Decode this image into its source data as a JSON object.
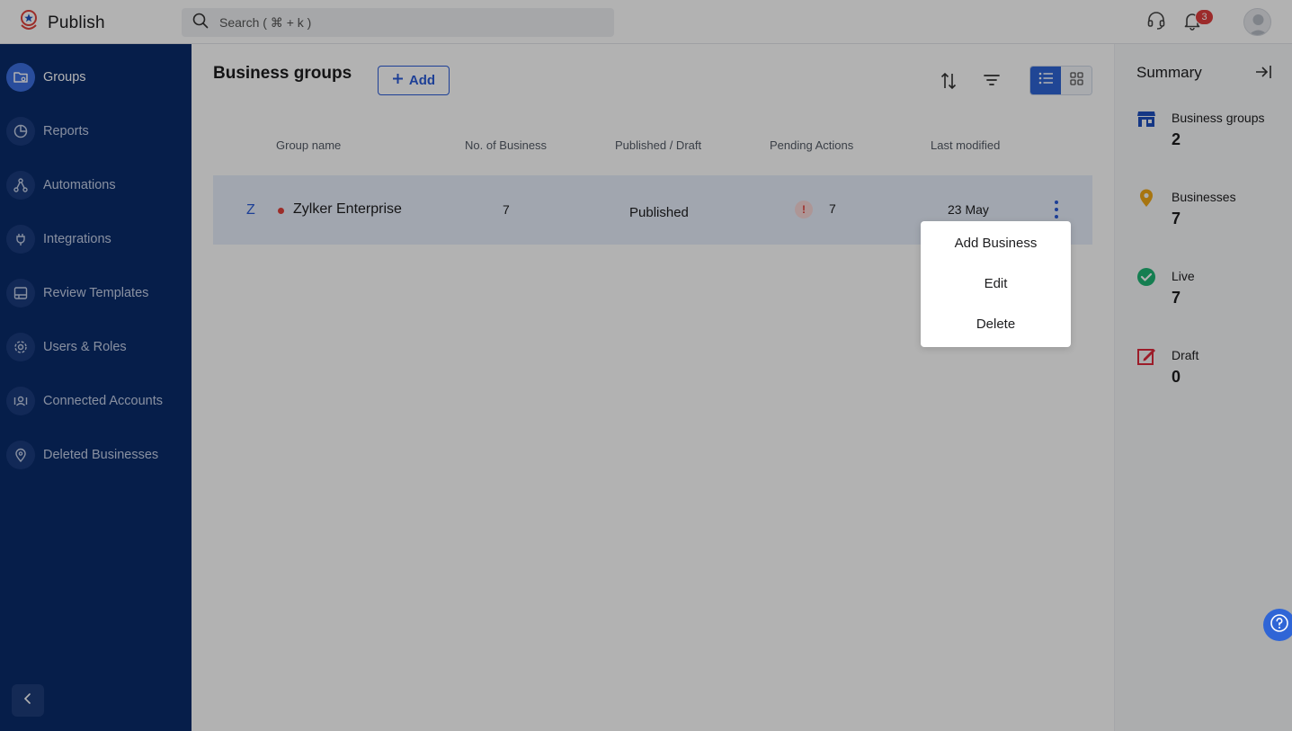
{
  "app": {
    "name": "Publish"
  },
  "search": {
    "placeholder": "Search ( ⌘ + k )"
  },
  "topbar": {
    "notification_count": "3"
  },
  "sidebar": {
    "items": [
      {
        "label": "Groups",
        "icon": "groups-icon",
        "active": true
      },
      {
        "label": "Reports",
        "icon": "reports-icon"
      },
      {
        "label": "Automations",
        "icon": "automations-icon"
      },
      {
        "label": "Integrations",
        "icon": "integrations-icon"
      },
      {
        "label": "Review Templates",
        "icon": "review-templates-icon"
      },
      {
        "label": "Users & Roles",
        "icon": "users-roles-icon"
      },
      {
        "label": "Connected Accounts",
        "icon": "connected-accounts-icon"
      },
      {
        "label": "Deleted Businesses",
        "icon": "deleted-businesses-icon"
      }
    ]
  },
  "main": {
    "title": "Business groups",
    "add_label": "Add",
    "columns": [
      "Group name",
      "No. of Business",
      "Published / Draft",
      "Pending Actions",
      "Last modified"
    ],
    "rows": [
      {
        "initial": "Z",
        "name": "Zylker Enterprise",
        "businesses": "7",
        "status": "Published",
        "pending": "7",
        "modified": "23 May"
      }
    ]
  },
  "menu": {
    "items": [
      "Add Business",
      "Edit",
      "Delete"
    ],
    "highlighted": "Delete"
  },
  "summary": {
    "title": "Summary",
    "items": [
      {
        "label": "Business groups",
        "value": "2",
        "icon": "store-icon",
        "color": "#1f4fbf"
      },
      {
        "label": "Businesses",
        "value": "7",
        "icon": "location-pin-icon",
        "color": "#f0a818"
      },
      {
        "label": "Live",
        "value": "7",
        "icon": "check-circle-icon",
        "color": "#1fb574"
      },
      {
        "label": "Draft",
        "value": "0",
        "icon": "draft-edit-icon",
        "color": "#e0293b"
      }
    ]
  },
  "colors": {
    "sidebar": "#0a2b6b",
    "accent": "#2a5bd7",
    "overlay": "rgba(0,0,0,0.30)"
  }
}
